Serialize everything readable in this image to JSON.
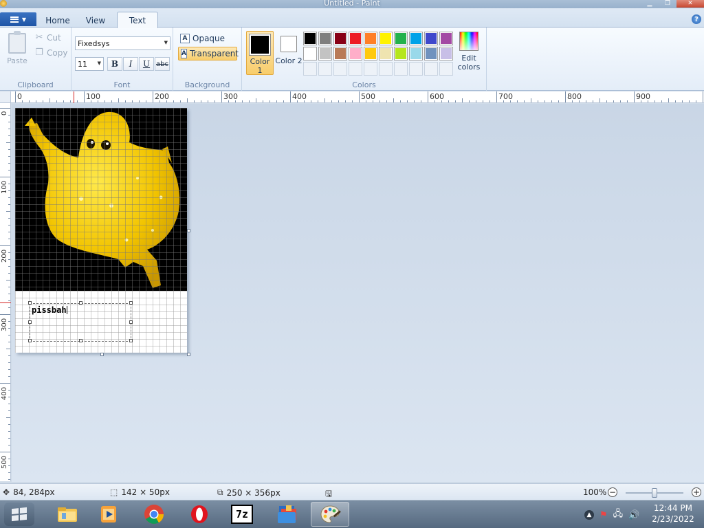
{
  "window": {
    "title": "Untitled - Paint"
  },
  "ribbon_tabs": {
    "home": "Home",
    "view": "View",
    "text": "Text"
  },
  "clipboard": {
    "paste": "Paste",
    "cut": "Cut",
    "copy": "Copy",
    "label": "Clipboard"
  },
  "font": {
    "family": "Fixedsys",
    "size": "11",
    "label": "Font",
    "bold": "B",
    "italic": "I",
    "underline": "U",
    "strike": "abc"
  },
  "background": {
    "opaque": "Opaque",
    "transparent": "Transparent",
    "label": "Background",
    "icon_letter": "A"
  },
  "colors": {
    "label": "Colors",
    "color1": "Color 1",
    "color2": "Color 2",
    "edit": "Edit colors",
    "color1_value": "#000000",
    "color2_value": "#ffffff",
    "palette_row1": [
      "#000000",
      "#7f7f7f",
      "#880015",
      "#ed1c24",
      "#ff7f27",
      "#fff200",
      "#22b14c",
      "#00a2e8",
      "#3f48cc",
      "#a349a4"
    ],
    "palette_row2": [
      "#ffffff",
      "#c3c3c3",
      "#b97a57",
      "#ffaec9",
      "#ffc90e",
      "#efe4b0",
      "#b5e61d",
      "#99d9ea",
      "#7092be",
      "#c8bfe7"
    ],
    "palette_row3_empty": 10
  },
  "ruler": {
    "h_labels": [
      "0",
      "100",
      "200",
      "300",
      "400",
      "500",
      "600",
      "700",
      "800",
      "900"
    ],
    "v_labels": [
      "0",
      "100",
      "200",
      "300",
      "400",
      "500"
    ]
  },
  "canvas": {
    "text": "pissbah"
  },
  "status": {
    "cursor_pos": "84, 284px",
    "selection_size": "142 × 50px",
    "image_size": "250 × 356px",
    "zoom": "100%",
    "zoom_minus": "−",
    "zoom_plus": "+"
  },
  "taskbar": {
    "apps": [
      "explorer",
      "media-player",
      "chrome",
      "opera",
      "7-zip",
      "file-manager",
      "paint"
    ],
    "time": "12:44 PM",
    "date": "2/23/2022",
    "sevenzip_label": "7z"
  }
}
